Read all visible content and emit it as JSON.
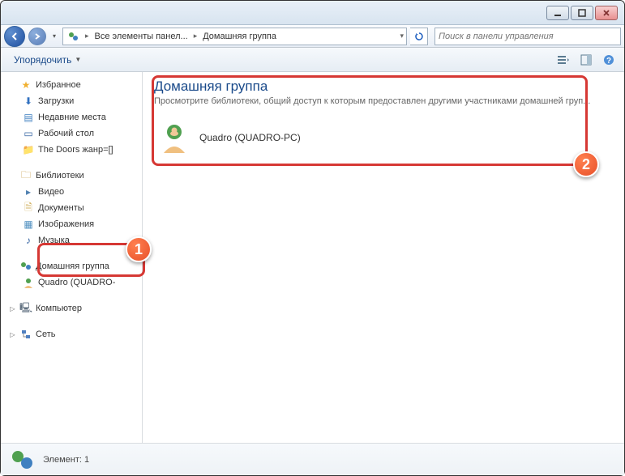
{
  "nav": {
    "breadcrumb": [
      {
        "label": "Все элементы панел..."
      },
      {
        "label": "Домашняя группа"
      }
    ],
    "search_placeholder": "Поиск в панели управления"
  },
  "toolbar": {
    "organize": "Упорядочить"
  },
  "sidebar": {
    "favorites": {
      "label": "Избранное",
      "items": [
        {
          "label": "Загрузки",
          "icon": "ico-down"
        },
        {
          "label": "Недавние места",
          "icon": "ico-recent"
        },
        {
          "label": "Рабочий стол",
          "icon": "ico-desk"
        },
        {
          "label": "The Doors жанр=[]",
          "icon": "ico-music-f"
        }
      ]
    },
    "libraries": {
      "label": "Библиотеки",
      "items": [
        {
          "label": "Видео",
          "icon": "ico-vid"
        },
        {
          "label": "Документы",
          "icon": "ico-doc"
        },
        {
          "label": "Изображения",
          "icon": "ico-img"
        },
        {
          "label": "Музыка",
          "icon": "ico-music"
        }
      ]
    },
    "homegroup": {
      "label": "Домашняя группа",
      "items": [
        {
          "label": "Quadro (QUADRO-",
          "icon": "ico-user"
        }
      ]
    },
    "computer": {
      "label": "Компьютер"
    },
    "network": {
      "label": "Сеть"
    }
  },
  "main": {
    "heading": "Домашняя группа",
    "description": "Просмотрите библиотеки, общий доступ к которым предоставлен другими участниками домашней груп...",
    "items": [
      {
        "label": "Quadro (QUADRO-PC)"
      }
    ]
  },
  "statusbar": {
    "text": "Элемент: 1"
  },
  "annotations": {
    "badge1": "1",
    "badge2": "2"
  }
}
